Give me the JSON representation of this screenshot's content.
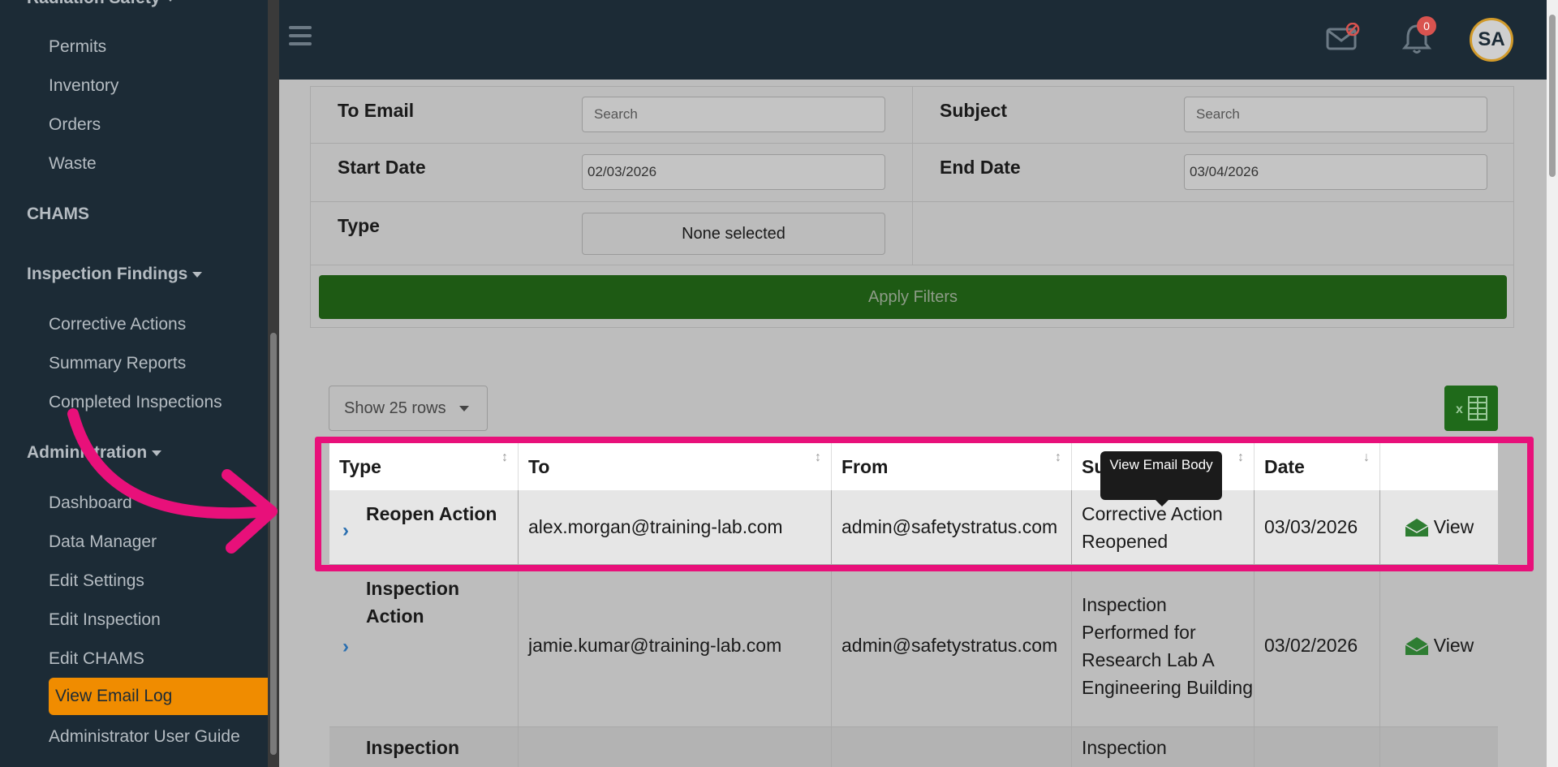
{
  "sidebar": {
    "partial_heading": "Radiation Safety",
    "radiation_items": [
      "Permits",
      "Inventory",
      "Orders",
      "Waste"
    ],
    "chams": "CHAMS",
    "inspection_findings": "Inspection Findings",
    "findings_items": [
      "Corrective Actions",
      "Summary Reports",
      "Completed Inspections"
    ],
    "administration": "Administration",
    "admin_items": [
      "Dashboard",
      "Data Manager",
      "Edit Settings",
      "Edit Inspection",
      "Edit CHAMS",
      "View Email Log",
      "Administrator User Guide"
    ],
    "active_item": "View Email Log"
  },
  "topbar": {
    "notification_count": "0",
    "avatar_initials": "SA"
  },
  "filters": {
    "to_email_label": "To Email",
    "to_email_placeholder": "Search",
    "subject_label": "Subject",
    "subject_placeholder": "Search",
    "start_date_label": "Start Date",
    "start_date_value": "02/03/2026",
    "end_date_label": "End Date",
    "end_date_value": "03/04/2026",
    "type_label": "Type",
    "type_value": "None selected",
    "apply_label": "Apply Filters"
  },
  "table_controls": {
    "rows_label": "Show 25 rows"
  },
  "table": {
    "headers": [
      "Type",
      "To",
      "From",
      "Subject",
      "Date",
      ""
    ],
    "rows": [
      {
        "type": "Reopen Action",
        "to": "alex.morgan@training-lab.com",
        "from": "admin@safetystratus.com",
        "subject": "Corrective Action Reopened",
        "date": "03/03/2026",
        "action": "View"
      },
      {
        "type": "Inspection Action",
        "to": "jamie.kumar@training-lab.com",
        "from": "admin@safetystratus.com",
        "subject": "Inspection Performed for Research Lab A Engineering Building",
        "date": "03/02/2026",
        "action": "View"
      },
      {
        "type": "Inspection",
        "to": "",
        "from": "",
        "subject": "Inspection",
        "date": "",
        "action": ""
      }
    ]
  },
  "tooltip": "View Email Body",
  "colors": {
    "sidebar_bg": "#1c2b36",
    "active_item": "#f08c00",
    "highlight": "#e8107a",
    "apply_button": "#1e5a14",
    "view_icon": "#2e7d32"
  }
}
